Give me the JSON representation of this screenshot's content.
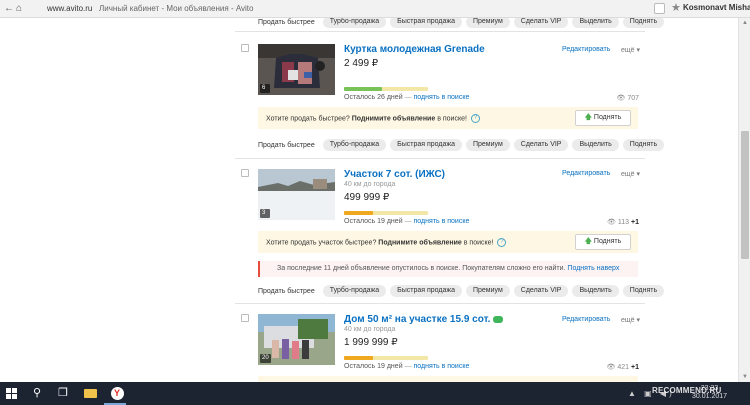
{
  "browser": {
    "url_host": "www.avito.ru",
    "url_title": "Личный кабинет - Мои объявления - Avito",
    "profile_name": "Kosmonavt Misha"
  },
  "actions": {
    "label": "Продать быстрее",
    "pills": [
      "Турбо-продажа",
      "Быстрая продажа",
      "Премиум",
      "Сделать VIP",
      "Выделить",
      "Поднять"
    ]
  },
  "ads": [
    {
      "title": "Куртка молодежная Grenade",
      "subtitle": "",
      "price": "2 499 ₽",
      "photo_count": "6",
      "progress": 0.45,
      "progress_color": "#78c257",
      "remain": "Осталось 26 дней",
      "lift_link": "поднять в поиске",
      "edit": "Редактировать",
      "more": "ещё",
      "views": "707",
      "plus": "",
      "promo_text": "Хотите продать быстрее?",
      "promo_bold": "Поднимите объявление",
      "promo_tail": "в поиске!",
      "lift_button": "Поднять"
    },
    {
      "title": "Участок 7 сот. (ИЖС)",
      "subtitle": "40 км до города",
      "price": "499 999 ₽",
      "photo_count": "3",
      "progress": 0.35,
      "progress_color": "#f0a91e",
      "remain": "Осталось 19 дней",
      "lift_link": "поднять в поиске",
      "edit": "Редактировать",
      "more": "ещё",
      "views": "113",
      "plus": "+1",
      "promo_text": "Хотите продать участок быстрее?",
      "promo_bold": "Поднимите объявление",
      "promo_tail": "в поиске!",
      "lift_button": "Поднять",
      "warning": "За последние 11 дней объявление опустилось в поиске. Покупателям сложно его найти.",
      "warning_link": "Поднять наверх"
    },
    {
      "title": "Дом 50 м² на участке 15.9 сот.",
      "subtitle": "40 км до города",
      "price": "1 999 999 ₽",
      "photo_count": "20",
      "progress": 0.35,
      "progress_color": "#f0a91e",
      "remain": "Осталось 19 дней",
      "lift_link": "поднять в поиске",
      "edit": "Редактировать",
      "more": "ещё",
      "views": "421",
      "plus": "+1"
    }
  ],
  "taskbar": {
    "clock_time": "23:33",
    "clock_date": "30.01.2017"
  },
  "watermark": "RECOMMEND.RU"
}
